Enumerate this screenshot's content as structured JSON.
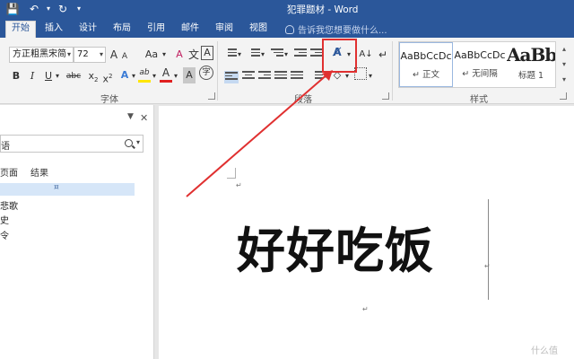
{
  "window": {
    "title": "犯罪题材 - Word",
    "qat": {
      "save_icon": "💾",
      "undo_icon": "↶",
      "redo_icon": "↻",
      "more_icon": "▾"
    }
  },
  "tabs": [
    "开始",
    "插入",
    "设计",
    "布局",
    "引用",
    "邮件",
    "审阅",
    "视图"
  ],
  "tell_me": "告诉我您想要做什么...",
  "font_group": {
    "label": "字体",
    "font_name": "方正粗黑宋简",
    "font_size": "72",
    "grow": "A",
    "shrink": "A",
    "case": "Aa",
    "clear": "A",
    "bold": "B",
    "italic": "I",
    "underline": "U",
    "strike": "abc",
    "subscript": "x",
    "superscript": "x",
    "text_effect": "A",
    "highlight": "ab",
    "font_color": "A",
    "char_shade": "A",
    "enclose": "A",
    "highlight_color": "#ffe600",
    "font_color_value": "#e02020"
  },
  "paragraph_group": {
    "label": "段落",
    "sort": "A↓"
  },
  "styles_group": {
    "label": "样式",
    "items": [
      {
        "preview": "AaBbCcDc",
        "name": "↵ 正文"
      },
      {
        "preview": "AaBbCcDc",
        "name": "↵ 无间隔"
      },
      {
        "preview": "AaBb",
        "name": "标题 1"
      }
    ]
  },
  "nav_pane": {
    "search_value": "语",
    "tabs": [
      "页面",
      "结果"
    ],
    "selected_marker": "¤",
    "items": [
      "悲歌",
      "史",
      "令"
    ]
  },
  "document": {
    "heading": "好好吃饭"
  },
  "watermark": "什么值"
}
